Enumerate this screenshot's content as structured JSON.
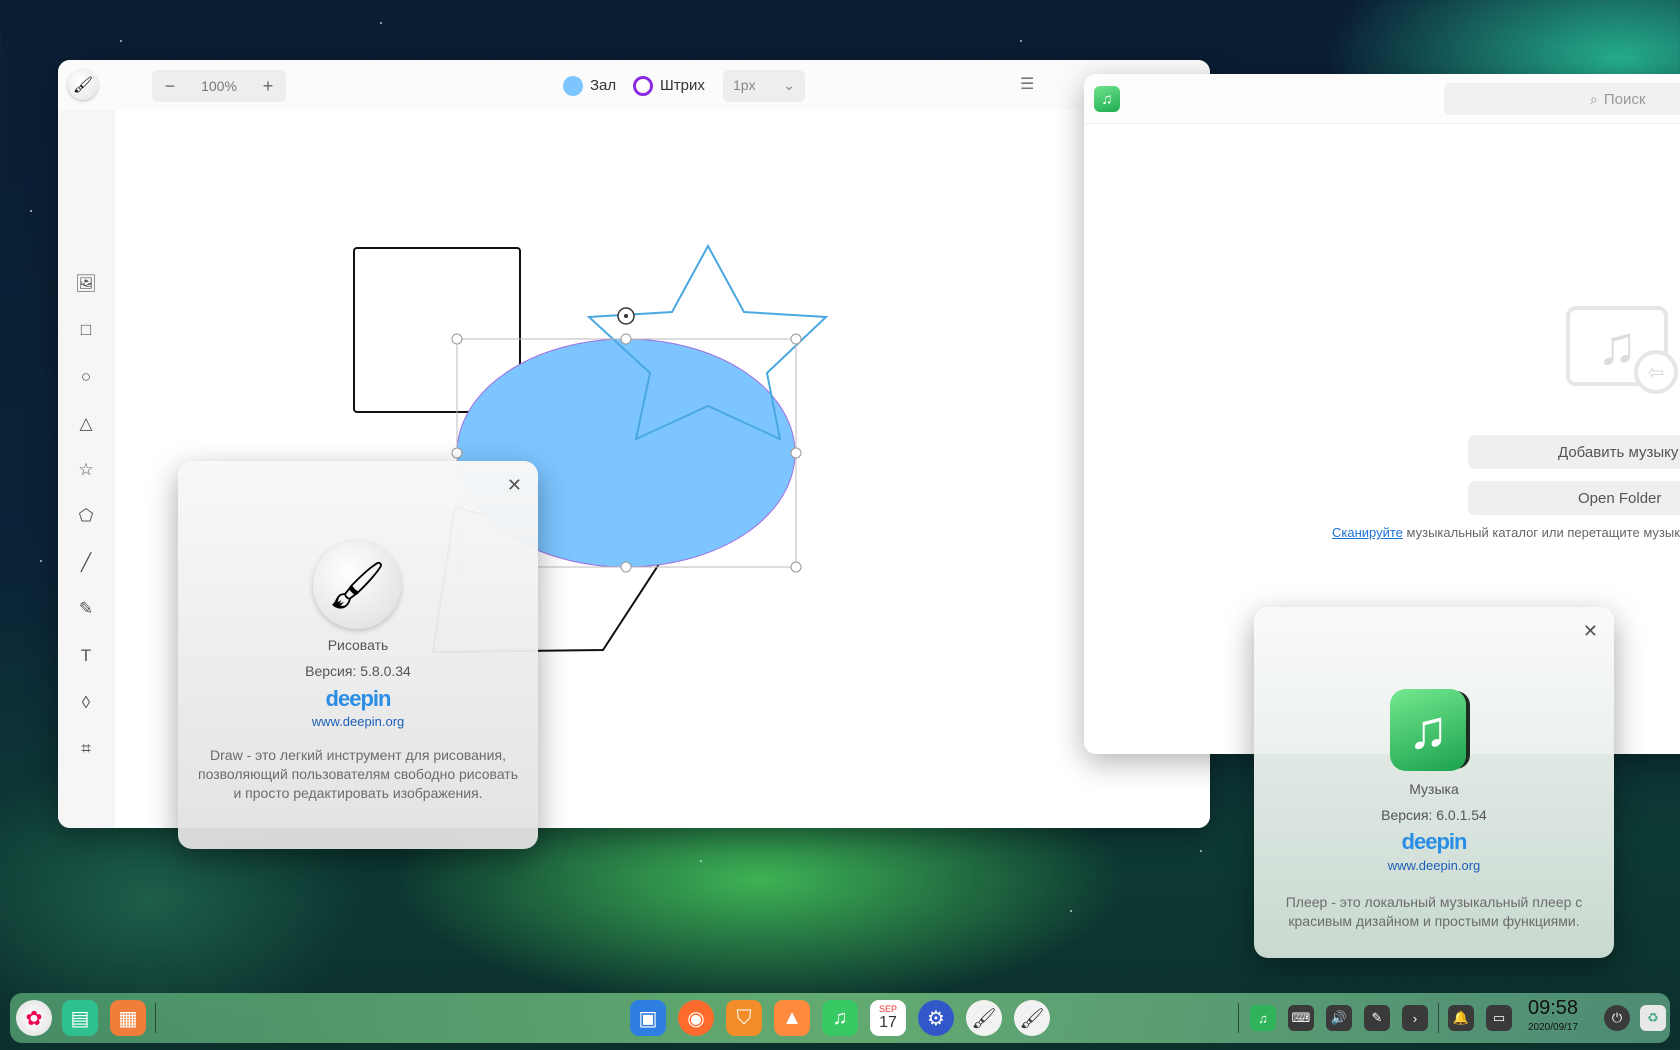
{
  "draw_window": {
    "zoom": {
      "minus": "−",
      "value": "100%",
      "plus": "+"
    },
    "fill_label": "Заливка",
    "stroke_label": "Штрих",
    "stroke_width": "1px",
    "menu_icon": "menu-icon",
    "tools": [
      "image-icon",
      "rectangle-icon",
      "ellipse-icon",
      "triangle-icon",
      "star-icon",
      "polygon-icon",
      "line-icon",
      "pencil-icon",
      "text-icon",
      "blur-icon",
      "crop-icon"
    ],
    "colors": {
      "fill": "#7cc5ff",
      "stroke": "#8a2be2",
      "star_stroke": "#4aa8e0"
    }
  },
  "about_draw": {
    "app_name": "Рисовать",
    "version": "Версия: 5.8.0.34",
    "brand": "deepin",
    "url": "www.deepin.org",
    "description": "Draw - это легкий инструмент для рисования, позволяющий пользователям свободно рисовать и просто редактировать изображения."
  },
  "music_window": {
    "search_placeholder": "Поиск",
    "add_music_button": "Добавить музыку",
    "open_folder_button": "Open Folder",
    "scan_link": "Сканируйте",
    "scan_hint": " музыкальный каталог или перетащите музыку сюда"
  },
  "about_music": {
    "app_name": "Музыка",
    "version": "Версия: 6.0.1.54",
    "brand": "deepin",
    "url": "www.deepin.org",
    "description": "Плеер - это локальный музыкальный плеер с красивым дизайном и простыми функциями."
  },
  "dock": {
    "calendar_month": "SEP",
    "calendar_day": "17",
    "clock_time": "09:58",
    "clock_date": "2020/09/17"
  }
}
